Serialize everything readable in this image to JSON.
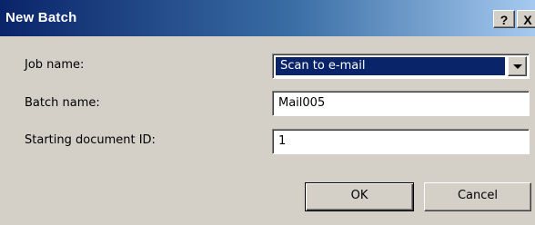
{
  "window": {
    "title": "New Batch",
    "help_label": "?",
    "close_label": "X"
  },
  "form": {
    "job_name": {
      "label": "Job name:",
      "selected": "Scan to e-mail"
    },
    "batch_name": {
      "label": "Batch name:",
      "value": "Mail005"
    },
    "starting_document_id": {
      "label": "Starting document ID:",
      "value": "1"
    }
  },
  "buttons": {
    "ok_label": "OK",
    "cancel_label": "Cancel"
  },
  "colors": {
    "titlebar_start": "#0a246a",
    "titlebar_end": "#a6caf0",
    "dialog_face": "#d4d0c8",
    "selection": "#0a246a"
  }
}
